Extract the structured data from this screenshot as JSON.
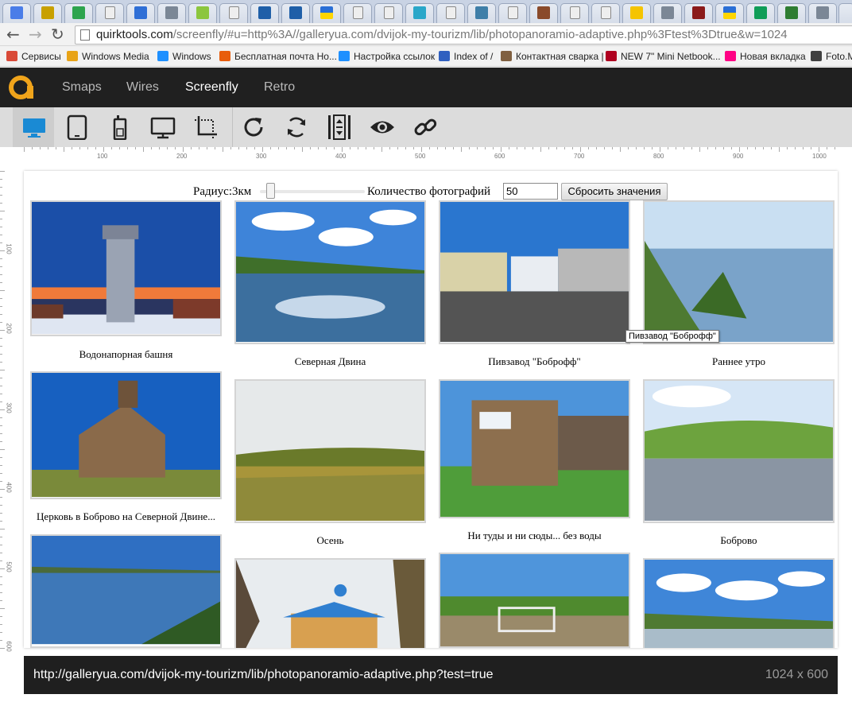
{
  "browser": {
    "url_host": "quirktools.com",
    "url_path": "/screenfly/#u=http%3A//galleryua.com/dvijok-my-tourizm/lib/photopanoramio-adaptive.php%3Ftest%3Dtrue&w=1024",
    "tab_favicons": [
      "g",
      "zz",
      "drive",
      "doc",
      "c",
      "h",
      "bolt",
      "doc",
      "fish",
      "fish",
      "ua",
      "doc",
      "doc",
      "globe",
      "doc",
      "pic",
      "doc",
      "color",
      "doc",
      "doc",
      "ad",
      "h",
      "r",
      "ua",
      "sheet",
      "info",
      "h"
    ]
  },
  "bookmarks": [
    {
      "label": "Сервисы",
      "icon": "apps-icon",
      "color": "#d94a38"
    },
    {
      "label": "Windows Media",
      "icon": "windows-icon",
      "color": "#e8a317"
    },
    {
      "label": "Windows",
      "icon": "windows-icon",
      "color": "#1e90ff"
    },
    {
      "label": "Бесплатная почта Но...",
      "icon": "windows-icon",
      "color": "#e85d0c"
    },
    {
      "label": "Настройка ссылок",
      "icon": "windows-icon",
      "color": "#1e90ff"
    },
    {
      "label": "Index of /",
      "icon": "two-icon",
      "color": "#3060c0"
    },
    {
      "label": "Контактная сварка |",
      "icon": "photo-icon",
      "color": "#806040"
    },
    {
      "label": "NEW 7\" Mini Netbook...",
      "icon": "bag-icon",
      "color": "#b00020"
    },
    {
      "label": "Новая вкладка",
      "icon": "flickr-icon",
      "color": "#ff0084"
    },
    {
      "label": "Foto.M",
      "icon": "camera-icon",
      "color": "#404040"
    }
  ],
  "app": {
    "nav": [
      "Smaps",
      "Wires",
      "Screenfly",
      "Retro"
    ],
    "active_nav": "Screenfly"
  },
  "toolbar": {
    "tools": [
      "desktop-icon",
      "tablet-icon",
      "phone-icon",
      "tv-icon",
      "custom-size-icon",
      "refresh-icon",
      "rotate-icon",
      "scroll-icon",
      "proxy-icon",
      "share-link-icon"
    ],
    "active": "desktop-icon"
  },
  "ruler": {
    "h": [
      "100",
      "200",
      "300",
      "400",
      "500",
      "600",
      "700",
      "800",
      "900",
      "1000"
    ],
    "v": [
      "100",
      "200",
      "300",
      "400",
      "500",
      "600"
    ]
  },
  "page": {
    "radius_label": "Радиус:3км",
    "count_label": "Количество фотографий",
    "count_value": "50",
    "reset_label": "Сбросить значения",
    "tooltip": "Пивзавод \"Боброфф\"",
    "photos": [
      {
        "caption": "Водонапорная башня",
        "scene": "tower"
      },
      {
        "caption": "Северная Двина",
        "scene": "river"
      },
      {
        "caption": "Пивзавод \"Боброфф\"",
        "scene": "truck"
      },
      {
        "caption": "Раннее утро",
        "scene": "morning"
      },
      {
        "caption": "Церковь в Боброво на Северной Двине...",
        "scene": "church"
      },
      {
        "caption": "Осень",
        "scene": "autumn"
      },
      {
        "caption": "Ни туды и ни сюды... без воды",
        "scene": "booth"
      },
      {
        "caption": "Боброво",
        "scene": "bobrovo"
      },
      {
        "caption": "",
        "scene": "lake"
      },
      {
        "caption": "",
        "scene": "chapel"
      },
      {
        "caption": "",
        "scene": "field"
      },
      {
        "caption": "",
        "scene": "clouds"
      }
    ]
  },
  "footer": {
    "url": "http://galleryua.com/dvijok-my-tourizm/lib/photopanoramio-adaptive.php?test=true",
    "size": "1024 x 600"
  }
}
